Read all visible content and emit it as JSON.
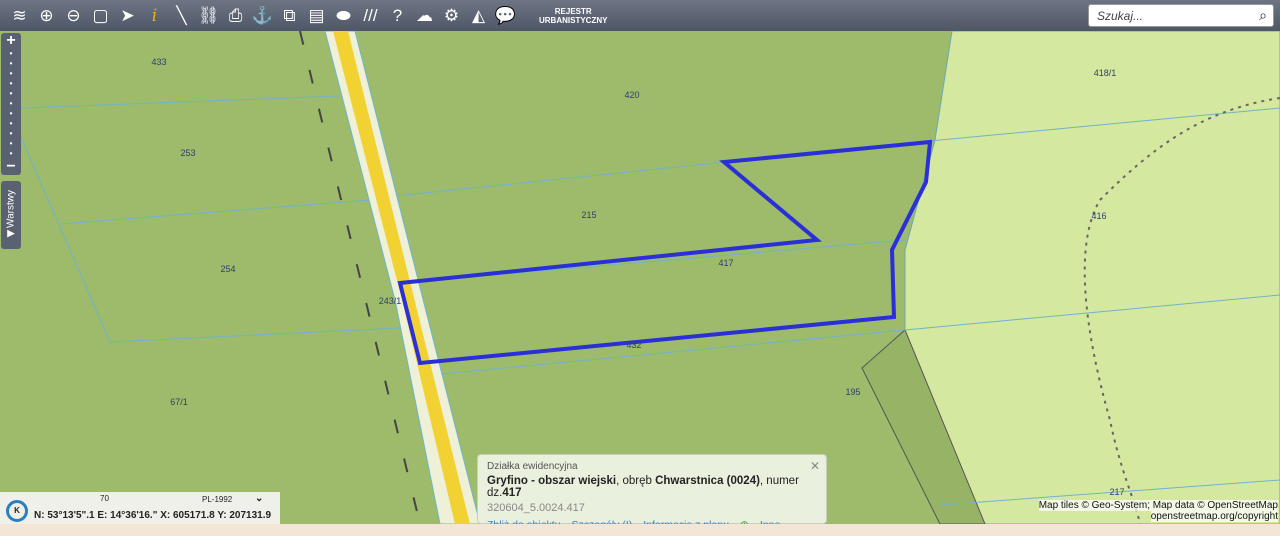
{
  "toolbar": {
    "icons": [
      "layers-icon",
      "zoom-in-icon",
      "zoom-out-icon",
      "full-extent-icon",
      "select-arrow-icon",
      "info-icon",
      "measure-icon",
      "link-icon",
      "print-icon",
      "download-icon",
      "copy-icon",
      "layout-icon",
      "shape-icon",
      "hatch-icon",
      "help-icon",
      "cloud-upload-icon",
      "settings-icon",
      "triangle-icon",
      "user-chat-icon"
    ],
    "rejestr_line1": "REJESTR",
    "rejestr_line2": "URBANISTYCZNY"
  },
  "search": {
    "placeholder": "Szukaj..."
  },
  "side": {
    "warstwy": "Warstwy"
  },
  "map": {
    "parcels": [
      "433",
      "420",
      "418/1",
      "253",
      "215",
      "416",
      "254",
      "417",
      "243/1",
      "432",
      "67/1",
      "195",
      "217"
    ],
    "colors": {
      "dark_green": "#9dbb6a",
      "light_green": "#d4e8a0",
      "selection": "#2a2fd8",
      "road": "#f2d233"
    }
  },
  "coords": {
    "system": "PL-1992",
    "scale": "70",
    "n": "N: 53°13'5\".1",
    "e": "E: 14°36'16.\"",
    "x": "X: 605171.8",
    "y": "Y: 207131.9"
  },
  "popup": {
    "title": "Działka ewidencyjna",
    "gmina": "Gryfino - obszar wiejski",
    "obreb_label": ", obręb ",
    "obreb": "Chwarstnica (0024)",
    "numer_label": ", numer dz.",
    "numer": "417",
    "id": "320604_5.0024.417",
    "links": [
      "Zbliż do obiektu",
      "Szczegóły (I)",
      "Informacja z planu",
      "Inne"
    ]
  },
  "attribution": {
    "line1": "Map tiles © Geo-System; Map data © OpenStreetMap",
    "line2": "openstreetmap.org/copyright"
  }
}
